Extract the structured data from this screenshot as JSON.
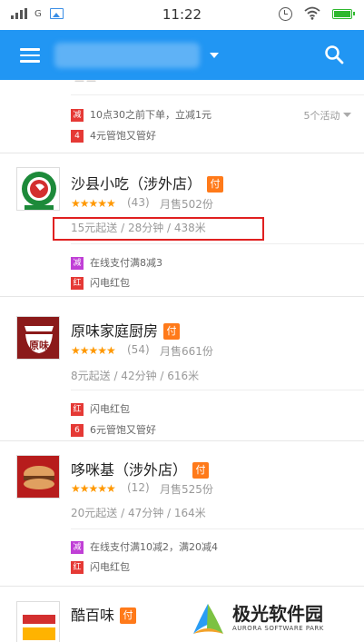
{
  "status_bar": {
    "network": "G",
    "time": "11:22"
  },
  "app_bar": {
    "location": "",
    "icons": [
      "menu-icon",
      "chevron-down-icon",
      "search-icon"
    ]
  },
  "partial_card": {
    "promos": [
      {
        "badge": "减",
        "badge_color": "#e53935",
        "text": "10点30之前下单，立减1元"
      },
      {
        "badge": "4",
        "badge_color": "#e53935",
        "text": "4元管饱又管好"
      }
    ],
    "activity_count": "5个活动"
  },
  "shops": [
    {
      "name": "沙县小吃（涉外店）",
      "pay_badge": "付",
      "stars": "★★★★★",
      "rating_value": 4.5,
      "rating_count": "(43)",
      "monthly_sales": "月售502份",
      "delivery": "15元起送 / 28分钟 / 438米",
      "promos": [
        {
          "badge": "减",
          "badge_color": "#c03fd6",
          "text": "在线支付满8减3"
        },
        {
          "badge": "红",
          "badge_color": "#e53935",
          "text": "闪电红包"
        }
      ]
    },
    {
      "name": "原味家庭厨房",
      "pay_badge": "付",
      "logo_text": "原味",
      "stars": "★★★★★",
      "rating_value": 4.5,
      "rating_count": "(54)",
      "monthly_sales": "月售661份",
      "delivery": "8元起送 / 42分钟 / 616米",
      "promos": [
        {
          "badge": "红",
          "badge_color": "#e53935",
          "text": "闪电红包"
        },
        {
          "badge": "6",
          "badge_color": "#e53935",
          "text": "6元管饱又管好"
        }
      ]
    },
    {
      "name": "哆咪基（涉外店）",
      "pay_badge": "付",
      "stars": "★★★★★",
      "rating_value": 5,
      "rating_count": "(12)",
      "monthly_sales": "月售525份",
      "delivery": "20元起送 / 47分钟 / 164米",
      "promos": [
        {
          "badge": "减",
          "badge_color": "#c03fd6",
          "text": "在线支付满10减2，满20减4"
        },
        {
          "badge": "红",
          "badge_color": "#e53935",
          "text": "闪电红包"
        }
      ]
    },
    {
      "name": "酷百味",
      "pay_badge": "付"
    }
  ],
  "watermark": {
    "title": "极光软件园",
    "subtitle": "AURORA SOFTWARE PARK"
  },
  "colors": {
    "primary": "#2196f3",
    "pay_badge": "#ff7a1a",
    "star": "#ff9800",
    "highlight": "#e02020"
  }
}
